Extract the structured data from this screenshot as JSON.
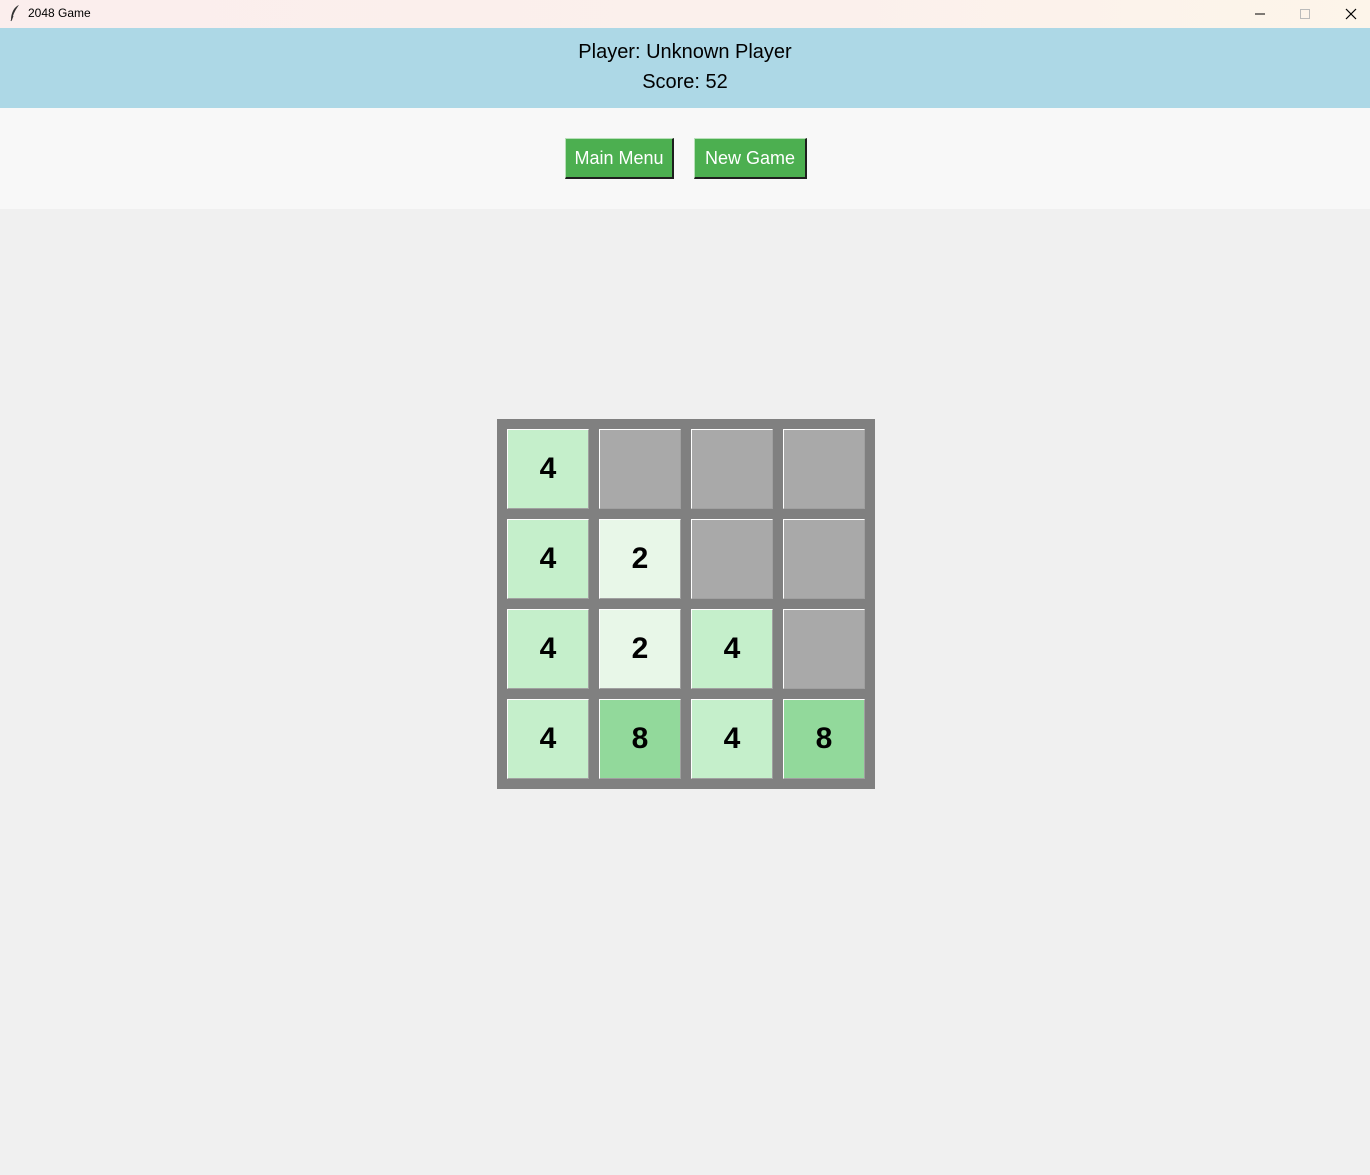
{
  "window": {
    "title": "2048 Game",
    "controls": [
      "minimize",
      "maximize",
      "close"
    ]
  },
  "header": {
    "player_text": "Player: Unknown Player",
    "score_text": "Score: 52",
    "background": "#add8e6"
  },
  "toolbar": {
    "main_menu_label": "Main Menu",
    "new_game_label": "New Game",
    "button_color": "#4caf50"
  },
  "board": {
    "size": 4,
    "grid": [
      [
        4,
        null,
        null,
        null
      ],
      [
        4,
        2,
        null,
        null
      ],
      [
        4,
        2,
        4,
        null
      ],
      [
        4,
        8,
        4,
        8
      ]
    ],
    "tile_colors": {
      "empty": "#a9a9a9",
      "2": "#e8f7e8",
      "4": "#c5efcb",
      "8": "#92d99b"
    },
    "background": "#808080"
  }
}
